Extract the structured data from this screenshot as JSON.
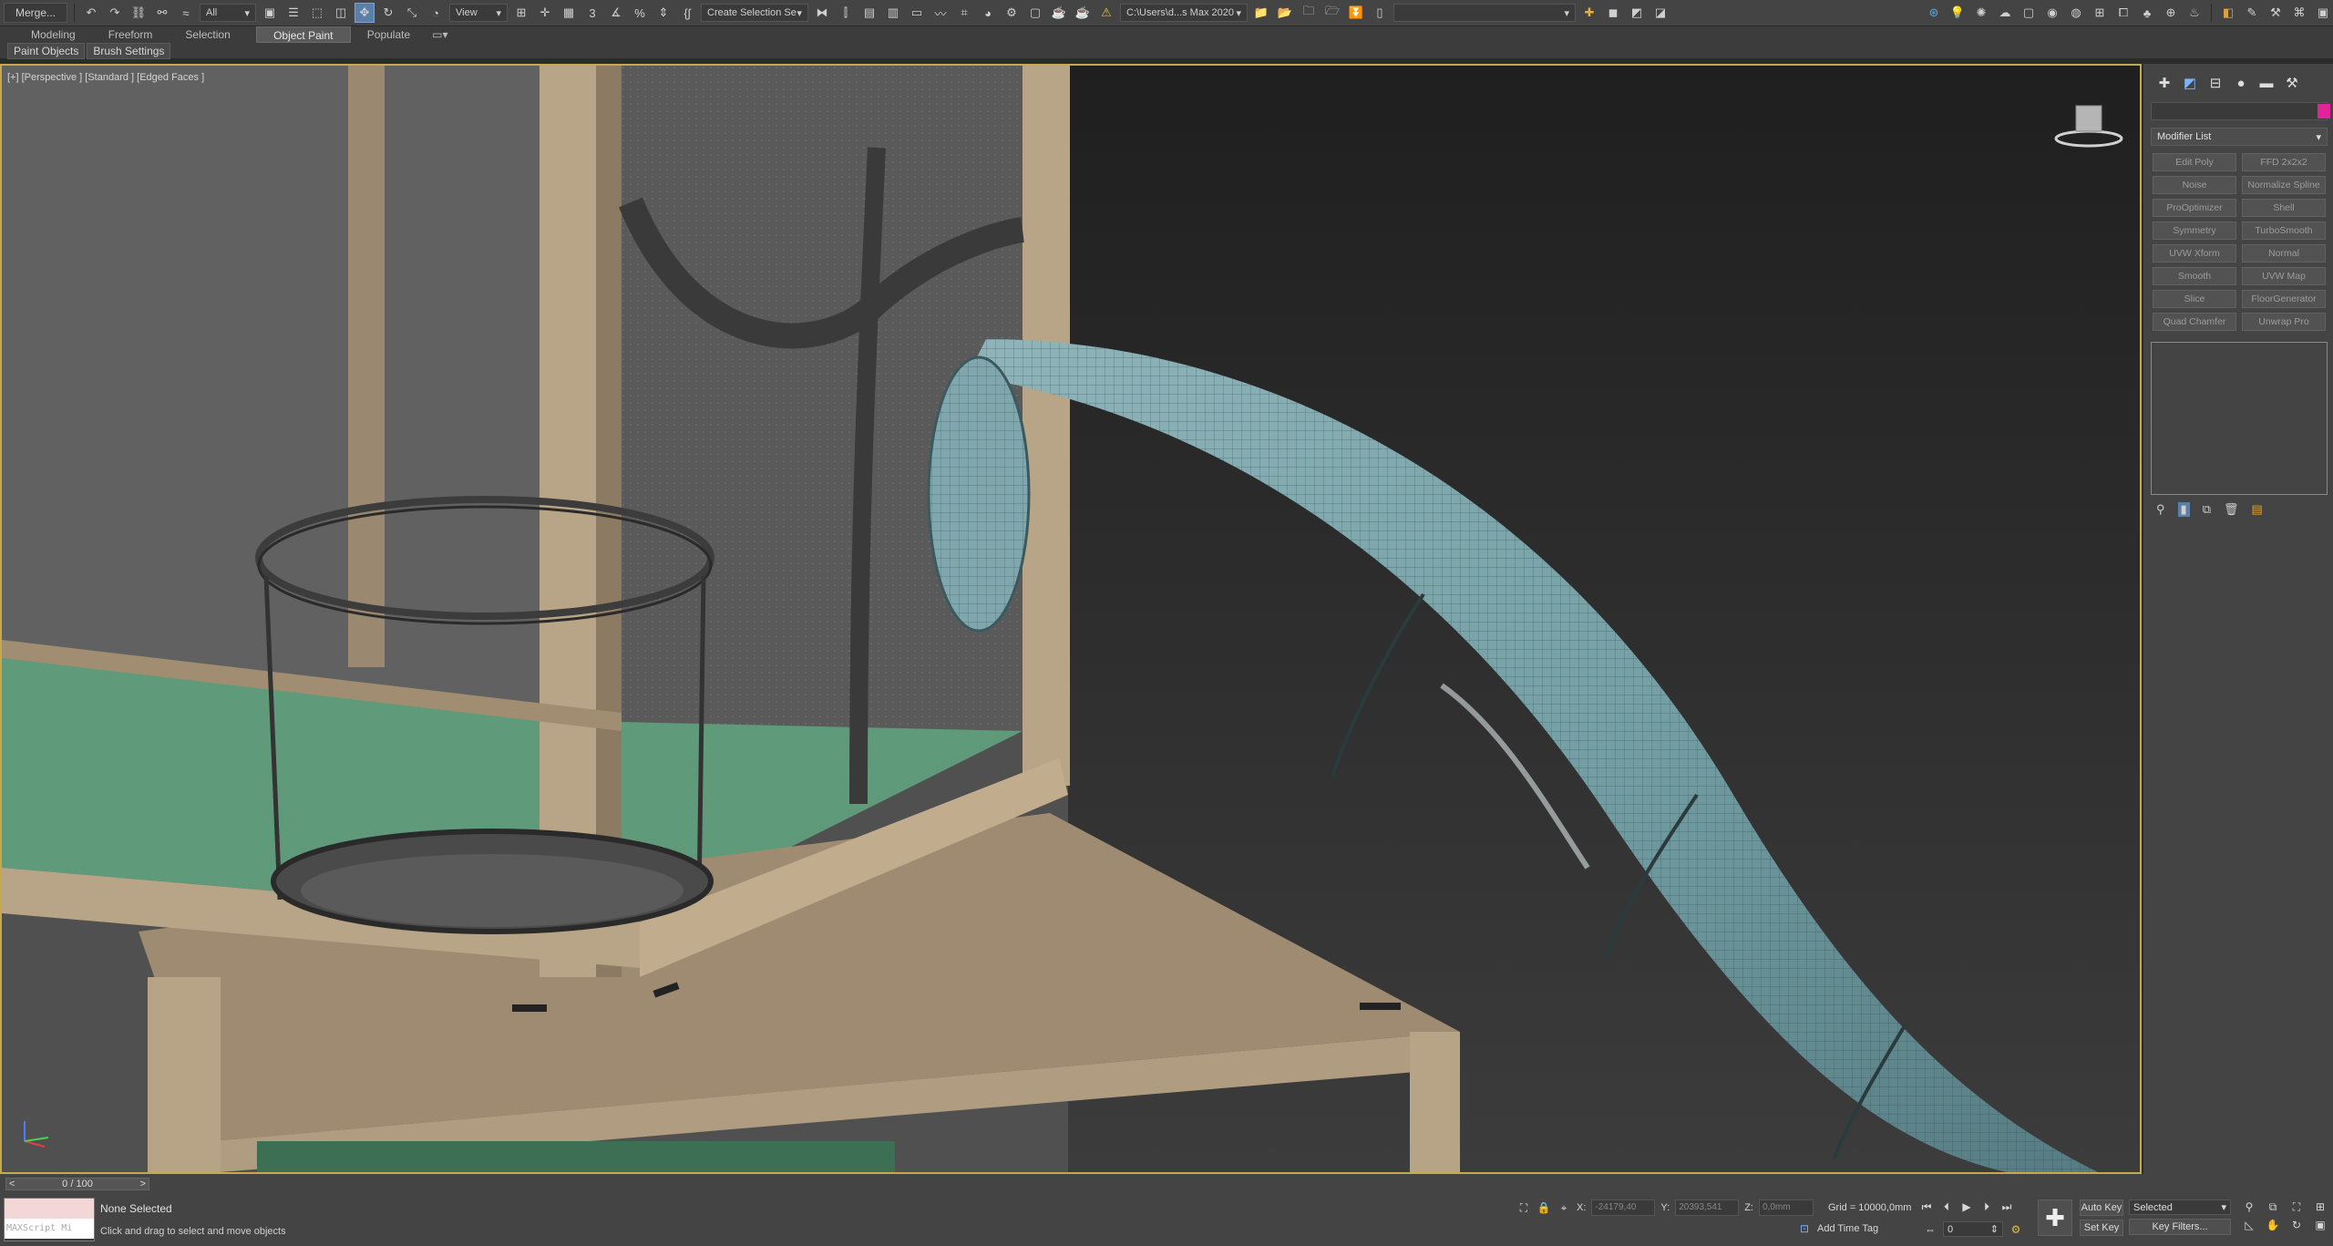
{
  "toolbar": {
    "merge_label": "Merge...",
    "filter_select": "All",
    "ref_coord_select": "View",
    "named_selection": "Create Selection Se",
    "project_path": "C:\\Users\\d...s Max 2020",
    "workspace_select": ""
  },
  "ribbon": {
    "tabs": [
      "Modeling",
      "Freeform",
      "Selection",
      "Object Paint",
      "Populate"
    ],
    "active_tab": "Object Paint",
    "sub_buttons": [
      "Paint Objects",
      "Brush Settings"
    ]
  },
  "viewport": {
    "label": "[+] [Perspective ] [Standard ] [Edged Faces ]",
    "colors": {
      "background": "#2d2d2d",
      "wood": "#a9957c",
      "green_floor": "#5f9b7a",
      "tube": "#7fa7ad",
      "border_active": "#c5a94c"
    }
  },
  "command_panel": {
    "tab_icons": [
      "create-icon",
      "modify-icon",
      "hierarchy-icon",
      "motion-icon",
      "display-icon",
      "utilities-icon"
    ],
    "object_color": "#e0249a",
    "modifier_list_label": "Modifier List",
    "modifier_buttons": [
      "Edit Poly",
      "FFD 2x2x2",
      "Noise",
      "Normalize Spline",
      "ProOptimizer",
      "Shell",
      "Symmetry",
      "TurboSmooth",
      "UVW Xform",
      "Normal",
      "Smooth",
      "UVW Map",
      "Slice",
      "FloorGenerator",
      "Quad Chamfer",
      "Unwrap Pro"
    ]
  },
  "status": {
    "time_slider": "0 / 100",
    "maxscript_label": "MAXScript Mi",
    "selection_status": "None Selected",
    "prompt": "Click and drag to select and move objects",
    "x_label": "X:",
    "x_value": "-24179,40",
    "y_label": "Y:",
    "y_value": "20393,541",
    "z_label": "Z:",
    "z_value": "0,0mm",
    "grid": "Grid = 10000,0mm",
    "add_time_tag": "Add Time Tag",
    "auto_key": "Auto Key",
    "selected_select": "Selected",
    "set_key": "Set Key",
    "key_filters": "Key Filters...",
    "frame_value": "0"
  }
}
